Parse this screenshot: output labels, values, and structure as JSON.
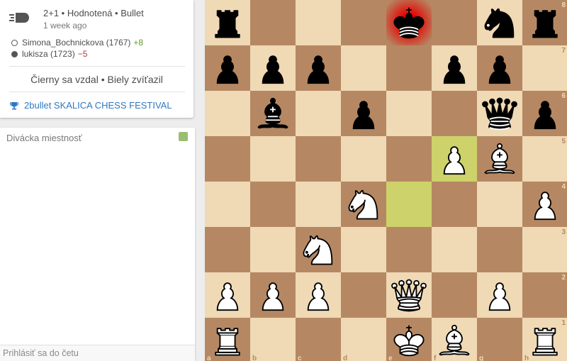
{
  "game": {
    "line": "2+1 • Hodnotená • Bullet",
    "ago": "1 week ago",
    "white_player": "Simona_Bochnickova (1767)",
    "white_diff": "+8",
    "black_player": "lukisza (1723)",
    "black_diff": "−5",
    "result": "Čierny sa vzdal • Biely zvíťazil",
    "tournament": "2bullet SKALICA CHESS FESTIVAL",
    "speed_icon": "bullet-icon",
    "tournament_icon": "trophy-icon"
  },
  "chat": {
    "title": "Divácka miestnosť",
    "input_placeholder": "Prihlásiť sa do četu",
    "toggle_color": "#9bbd72"
  },
  "board": {
    "colors": {
      "light": "#f0d9b5",
      "dark": "#b58863",
      "highlight": "#cdd26a",
      "check": "#ff0000"
    },
    "ranks": [
      "8",
      "7",
      "6",
      "5",
      "4",
      "3",
      "2",
      "1"
    ],
    "files": [
      "a",
      "b",
      "c",
      "d",
      "e",
      "f",
      "g",
      "h"
    ],
    "position": [
      [
        "bR",
        "",
        "",
        "",
        "bK",
        "",
        "bN",
        "bR"
      ],
      [
        "bP",
        "bP",
        "bP",
        "",
        "",
        "bP",
        "bP",
        ""
      ],
      [
        "",
        "bB",
        "",
        "bP",
        "",
        "",
        "bQ",
        "bP"
      ],
      [
        "",
        "",
        "",
        "",
        "",
        "wP",
        "wB",
        ""
      ],
      [
        "",
        "",
        "",
        "wN",
        "",
        "",
        "",
        "wP"
      ],
      [
        "",
        "",
        "wN",
        "",
        "",
        "",
        "",
        ""
      ],
      [
        "wP",
        "wP",
        "wP",
        "",
        "wQ",
        "",
        "wP",
        ""
      ],
      [
        "wR",
        "",
        "",
        "",
        "wK",
        "wB",
        "",
        "wR"
      ]
    ],
    "last_move": [
      "f5",
      "e4"
    ],
    "in_check": "e8"
  }
}
